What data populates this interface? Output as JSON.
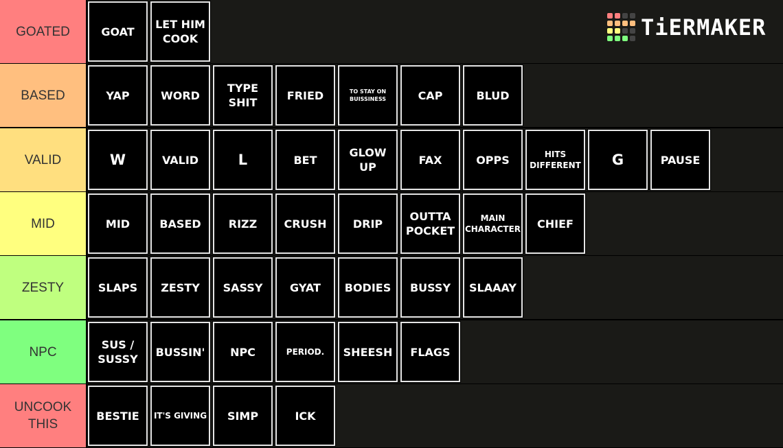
{
  "brand": {
    "name": "TiERMAKER",
    "icon": "tiermaker-grid-icon",
    "grid_colors": [
      "#ff7f7f",
      "#ff7f7f",
      "#444444",
      "#444444",
      "#ffbf7f",
      "#ffbf7f",
      "#ffbf7f",
      "#ffbf7f",
      "#ffff7f",
      "#ffff7f",
      "#444444",
      "#444444",
      "#7fff7f",
      "#7fff7f",
      "#7fff7f",
      "#444444"
    ]
  },
  "tiers": [
    {
      "label": "GOATED",
      "color": "#ff7f7f",
      "items": [
        "GOAT",
        "LET HIM COOK"
      ]
    },
    {
      "label": "BASED",
      "color": "#ffbf7f",
      "items": [
        "YAP",
        "WORD",
        "TYPE SHIT",
        "FRIED",
        "TO STAY ON BUISSINESS",
        "CAP",
        "BLUD"
      ]
    },
    {
      "label": "VALID",
      "color": "#ffdf7f",
      "items": [
        "W",
        "VALID",
        "L",
        "BET",
        "GLOW UP",
        "FAX",
        "OPPS",
        "HITS DIFFERENT",
        "G",
        "PAUSE"
      ]
    },
    {
      "label": "MID",
      "color": "#ffff7f",
      "items": [
        "MID",
        "BASED",
        "RIZZ",
        "CRUSH",
        "DRIP",
        "OUTTA POCKET",
        "MAIN CHARACTER",
        "CHIEF"
      ]
    },
    {
      "label": "ZESTY",
      "color": "#bfff7f",
      "items": [
        "SLAPS",
        "ZESTY",
        "SASSY",
        "GYAT",
        "BODIES",
        "BUSSY",
        "SLAAAY"
      ]
    },
    {
      "label": "NPC",
      "color": "#7fff7f",
      "items": [
        "SUS / SUSSY",
        "BUSSIN'",
        "NPC",
        "PERIOD.",
        "SHEESH",
        "FLAGS"
      ]
    },
    {
      "label": "UNCOOK THIS",
      "color": "#ff7f7f",
      "items": [
        "BESTIE",
        "IT'S GIVING",
        "SIMP",
        "ICK"
      ]
    }
  ]
}
